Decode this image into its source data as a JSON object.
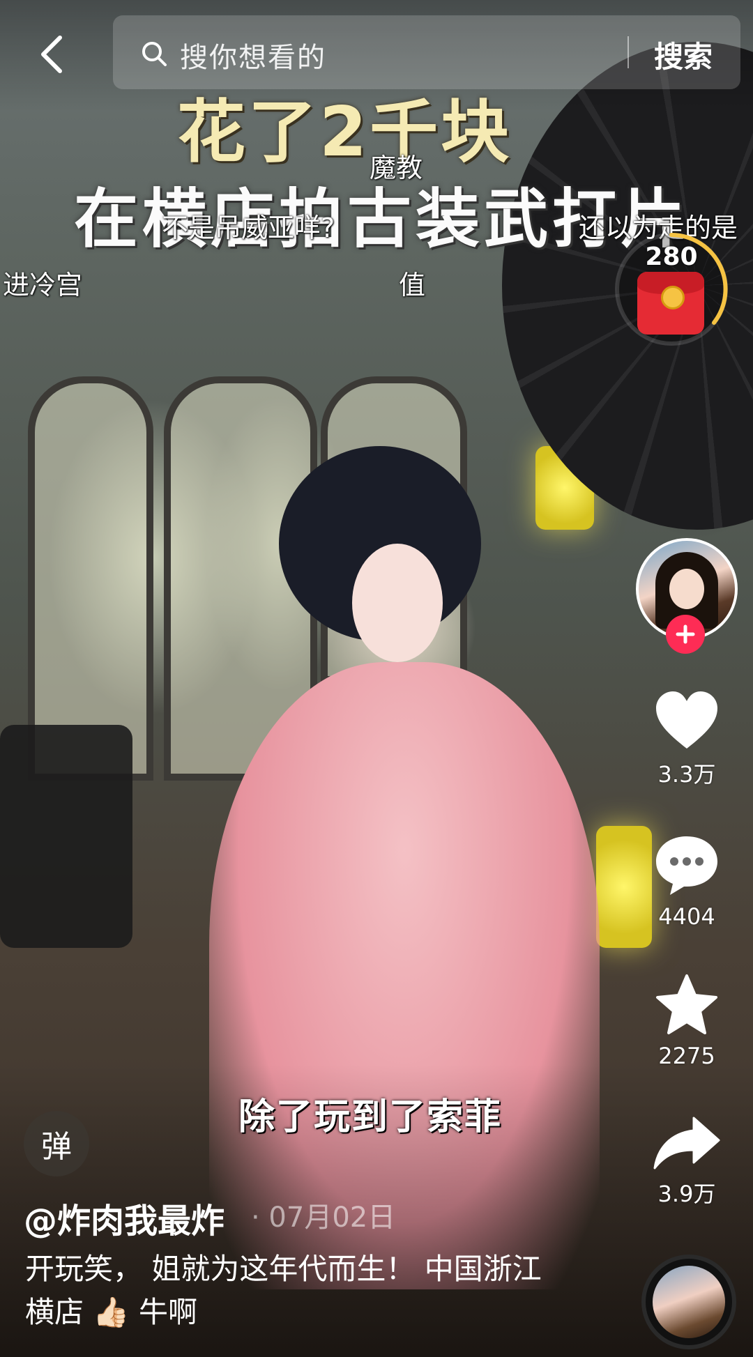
{
  "search": {
    "placeholder": "搜你想看的",
    "button_label": "搜索"
  },
  "video_title": {
    "line1": "花了2千块",
    "line2": "在横店拍古装武打片"
  },
  "danmaku": [
    {
      "text": "魔教"
    },
    {
      "text": "不是吊威亚咩?"
    },
    {
      "text": "还以为走的是"
    },
    {
      "text": "进冷宫"
    },
    {
      "text": "值"
    }
  ],
  "red_packet": {
    "count": "280"
  },
  "actions": {
    "like_count": "3.3万",
    "comment_count": "4404",
    "favorite_count": "2275",
    "share_count": "3.9万"
  },
  "subtitle": "除了玩到了索菲",
  "danmu_toggle_label": "弹",
  "post": {
    "author": "@炸肉我最炸",
    "date": "· 07月02日",
    "description": "开玩笑，  姐就为这年代而生！   中国浙江横店 👍🏻 牛啊"
  },
  "colors": {
    "accent": "#fe2c55",
    "title_yellow": "#f5eab3",
    "red_packet": "#e52b34"
  },
  "icons": {
    "back": "chevron-left-icon",
    "search": "search-icon",
    "like": "heart-icon",
    "comment": "comment-bubble-icon",
    "favorite": "star-icon",
    "share": "share-arrow-icon",
    "follow": "plus-icon"
  }
}
